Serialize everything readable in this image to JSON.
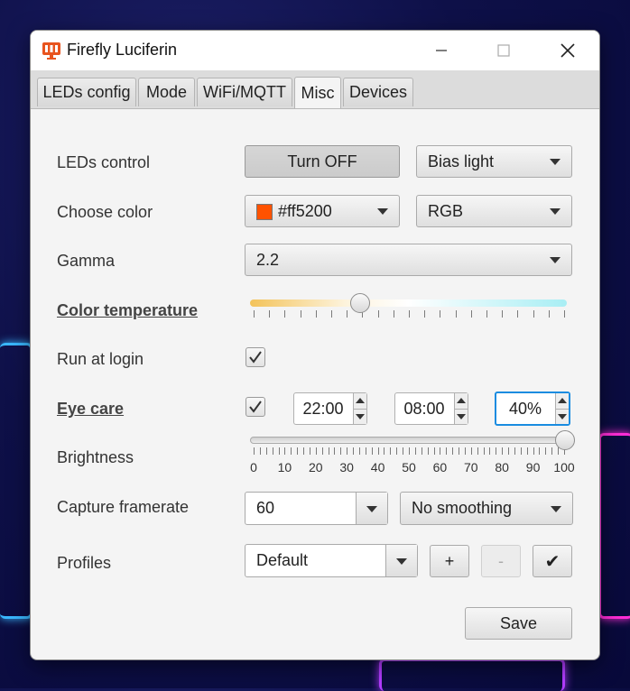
{
  "window": {
    "title": "Firefly Luciferin"
  },
  "tabs": [
    {
      "label": "LEDs config"
    },
    {
      "label": "Mode"
    },
    {
      "label": "WiFi/MQTT"
    },
    {
      "label": "Misc",
      "active": true
    },
    {
      "label": "Devices"
    }
  ],
  "leds_control": {
    "label": "LEDs control",
    "toggle_button": "Turn OFF",
    "mode_value": "Bias light"
  },
  "choose_color": {
    "label": "Choose color",
    "color_value": "#ff5200",
    "color_hex": "#ff5200",
    "format_value": "RGB"
  },
  "gamma": {
    "label": "Gamma",
    "value": "2.2"
  },
  "color_temperature": {
    "label": "Color temperature",
    "level": 0.34
  },
  "run_at_login": {
    "label": "Run at login",
    "checked": true
  },
  "eye_care": {
    "label": "Eye care",
    "checked": true,
    "start_time": "22:00",
    "end_time": "08:00",
    "brightness": "40%"
  },
  "brightness": {
    "label": "Brightness",
    "value": 100,
    "tick_labels": [
      "0",
      "10",
      "20",
      "30",
      "40",
      "50",
      "60",
      "70",
      "80",
      "90",
      "100"
    ]
  },
  "capture_framerate": {
    "label": "Capture framerate",
    "value": "60",
    "smoothing": "No smoothing"
  },
  "profiles": {
    "label": "Profiles",
    "value": "Default",
    "add": "+",
    "remove": "-",
    "apply": "✔"
  },
  "save_button": "Save",
  "colors": {
    "accent": "#1a8ce0",
    "swatch": "#ff5200",
    "temp_warm": "#f3c35a",
    "temp_cool": "#a8eef4"
  }
}
